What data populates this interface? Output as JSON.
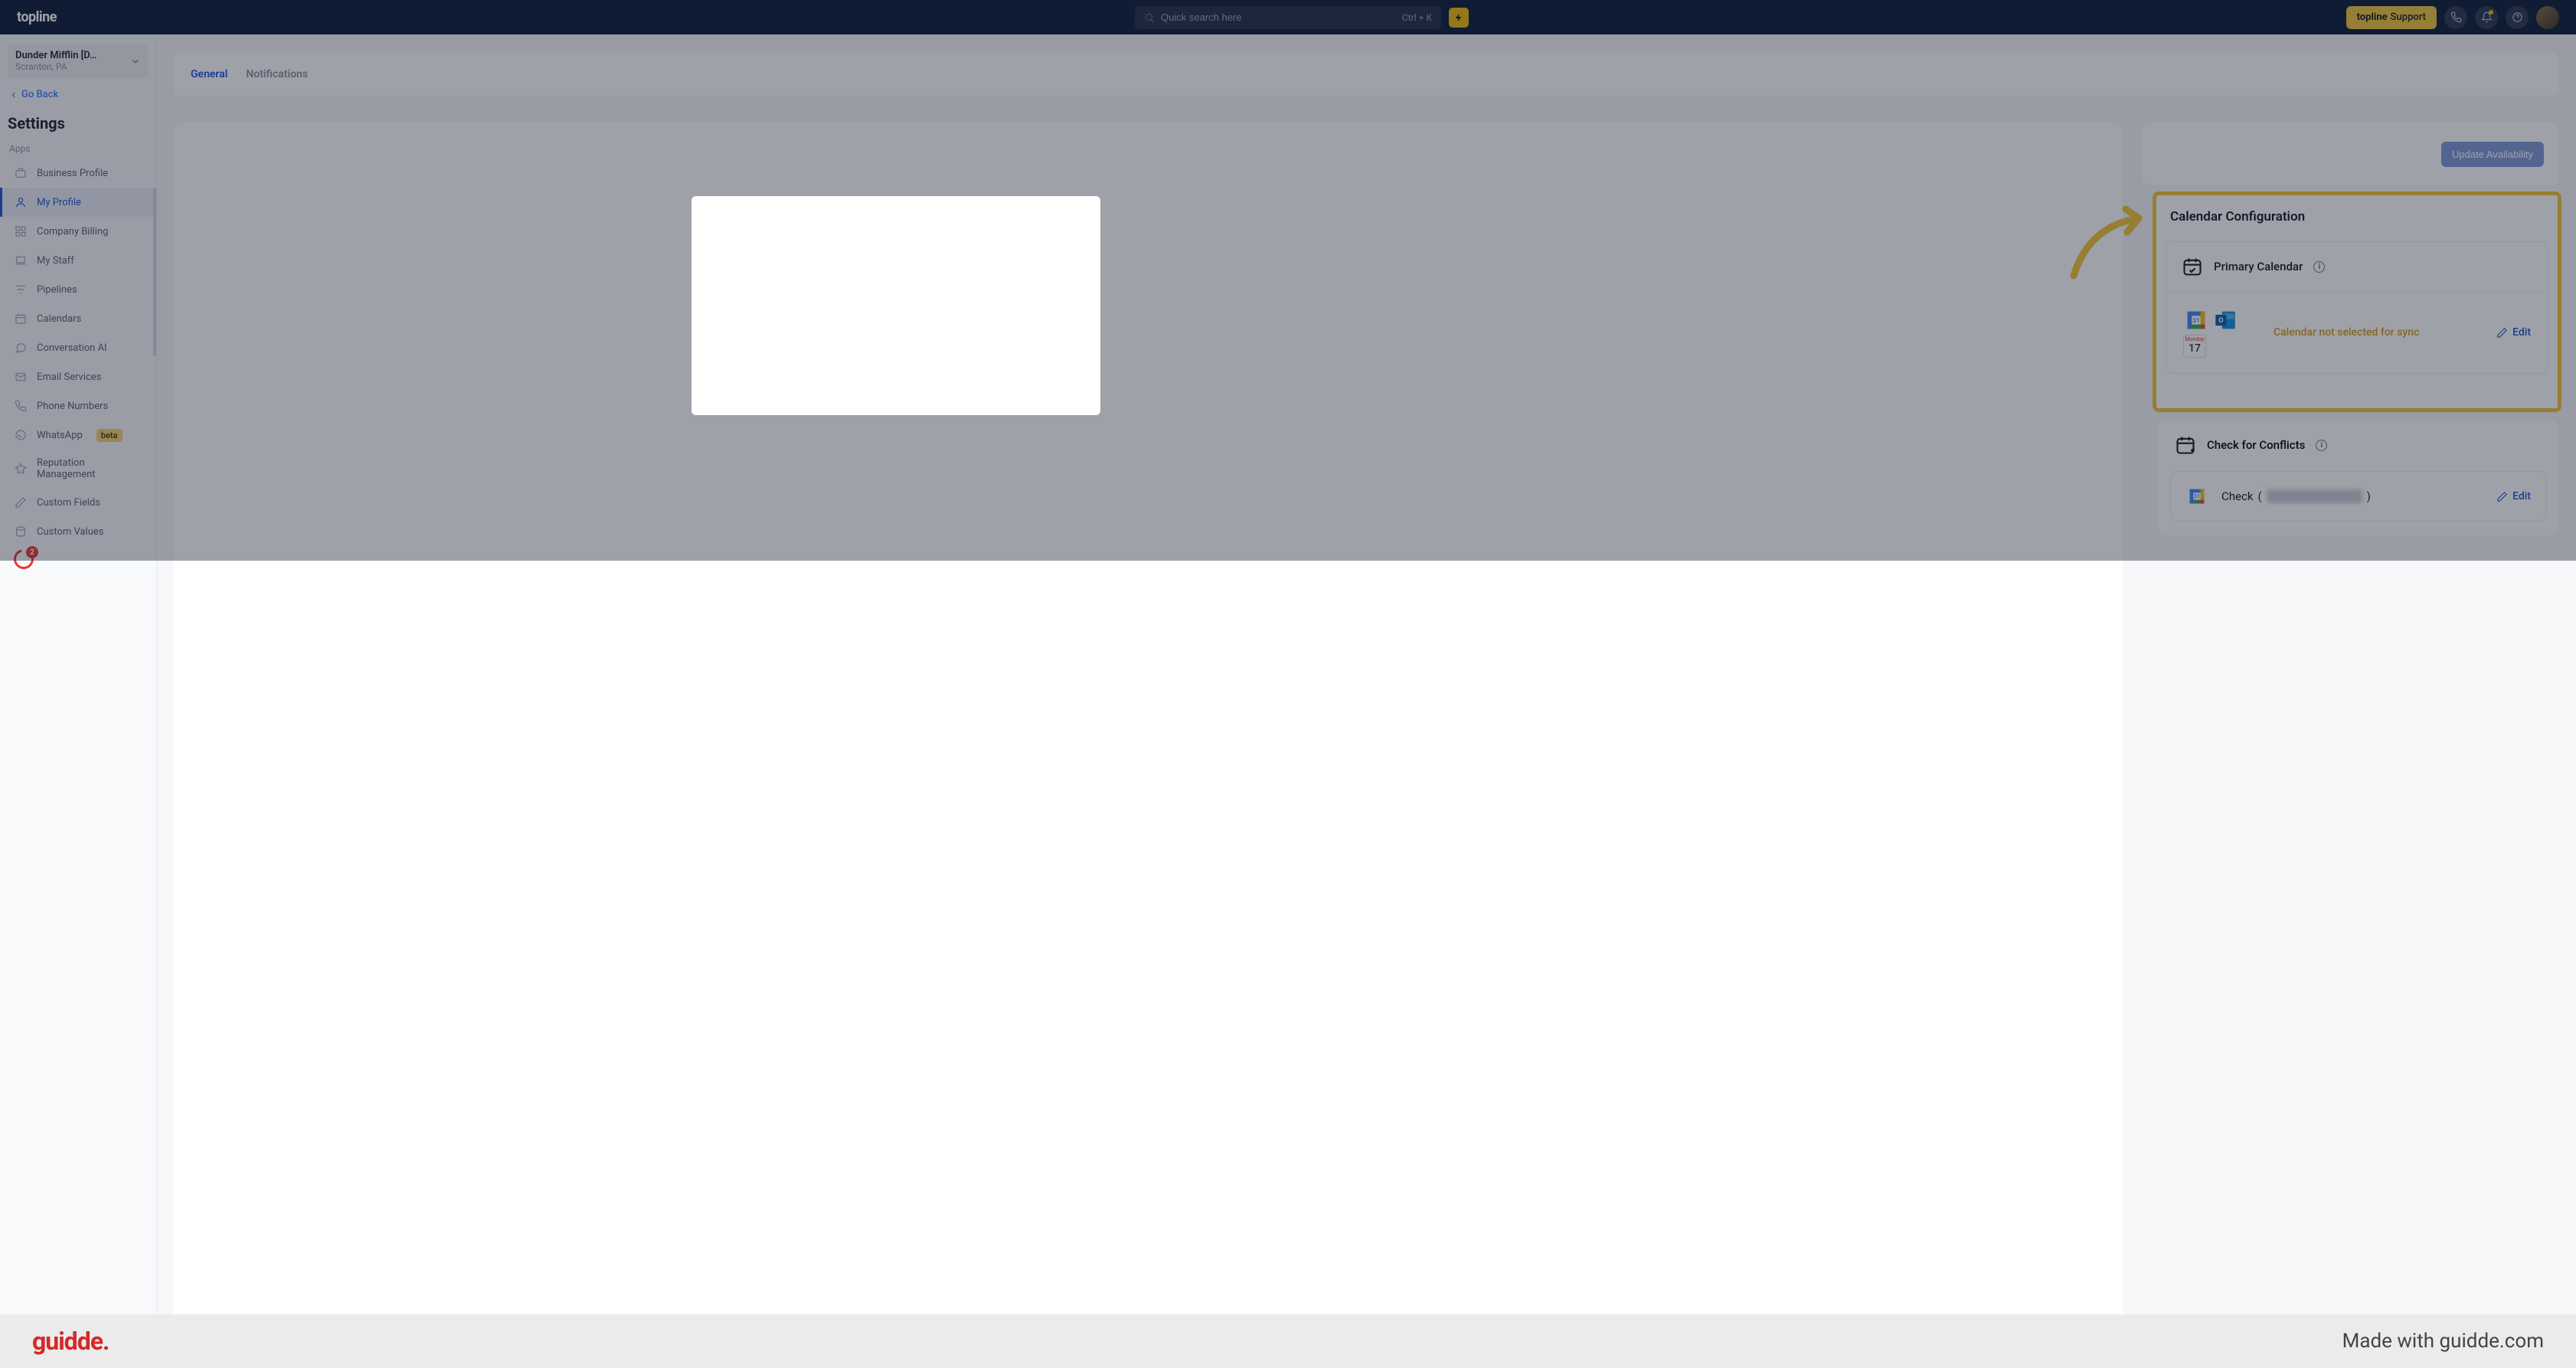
{
  "topnav": {
    "logo": "topline",
    "search_placeholder": "Quick search here",
    "search_kbd": "Ctrl + K",
    "support_brand": "topline",
    "support_label": "Support"
  },
  "sidebar": {
    "account_name": "Dunder Mifflin [D…",
    "account_loc": "Scranton, PA",
    "go_back": "Go Back",
    "heading": "Settings",
    "section": "Apps",
    "items": [
      {
        "label": "Business Profile"
      },
      {
        "label": "My Profile"
      },
      {
        "label": "Company Billing"
      },
      {
        "label": "My Staff"
      },
      {
        "label": "Pipelines"
      },
      {
        "label": "Calendars"
      },
      {
        "label": "Conversation AI"
      },
      {
        "label": "Email Services"
      },
      {
        "label": "Phone Numbers"
      },
      {
        "label": "WhatsApp"
      },
      {
        "label": "Reputation Management"
      },
      {
        "label": "Custom Fields"
      },
      {
        "label": "Custom Values"
      }
    ],
    "whatsapp_badge": "beta",
    "extra_count": "2"
  },
  "tabs": {
    "general": "General",
    "notifications": "Notifications"
  },
  "update_btn": "Update Availability",
  "cal_config": {
    "title": "Calendar Configuration",
    "primary_label": "Primary Calendar",
    "apple_day": "Monday",
    "apple_num": "17",
    "not_selected": "Calendar not selected for sync",
    "edit": "Edit"
  },
  "conflicts": {
    "title": "Check for Conflicts",
    "check_label": "Check",
    "edit": "Edit"
  },
  "footer": {
    "brand": "guidde.",
    "made": "Made with guidde.com"
  }
}
